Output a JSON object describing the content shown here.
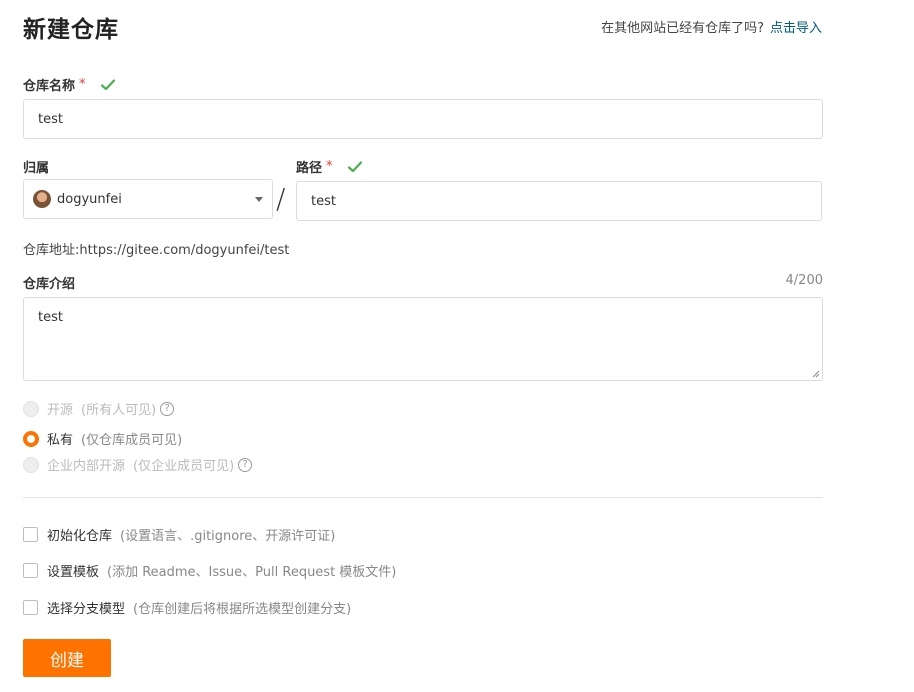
{
  "page": {
    "title": "新建仓库",
    "import_prompt": "在其他网站已经有仓库了吗?",
    "import_link": "点击导入"
  },
  "repo_name": {
    "label": "仓库名称",
    "required": "*",
    "value": "test"
  },
  "owner": {
    "label": "归属",
    "value": "dogyunfei"
  },
  "path": {
    "label": "路径",
    "required": "*",
    "value": "test"
  },
  "address": {
    "text": "仓库地址:https://gitee.com/dogyunfei/test"
  },
  "separator": "/",
  "description": {
    "label": "仓库介绍",
    "counter": "4/200",
    "value": "test"
  },
  "visibility": {
    "options": [
      {
        "label": "开源",
        "desc": "(所有人可见)",
        "state": "disabled",
        "help": "?"
      },
      {
        "label": "私有",
        "desc": "(仅仓库成员可见)",
        "state": "selected"
      },
      {
        "label": "企业内部开源",
        "desc": "(仅企业成员可见)",
        "state": "disabled",
        "help": "?"
      }
    ]
  },
  "options": [
    {
      "label": "初始化仓库",
      "desc": "(设置语言、.gitignore、开源许可证)",
      "checked": false
    },
    {
      "label": "设置模板",
      "desc": "(添加 Readme、Issue、Pull Request 模板文件)",
      "checked": false
    },
    {
      "label": "选择分支模型",
      "desc": "(仓库创建后将根据所选模型创建分支)",
      "checked": false
    }
  ],
  "submit": {
    "label": "创建"
  },
  "colors": {
    "accent": "#fe7300",
    "link": "#005980",
    "success": "#4caf50",
    "required": "#e53935"
  }
}
